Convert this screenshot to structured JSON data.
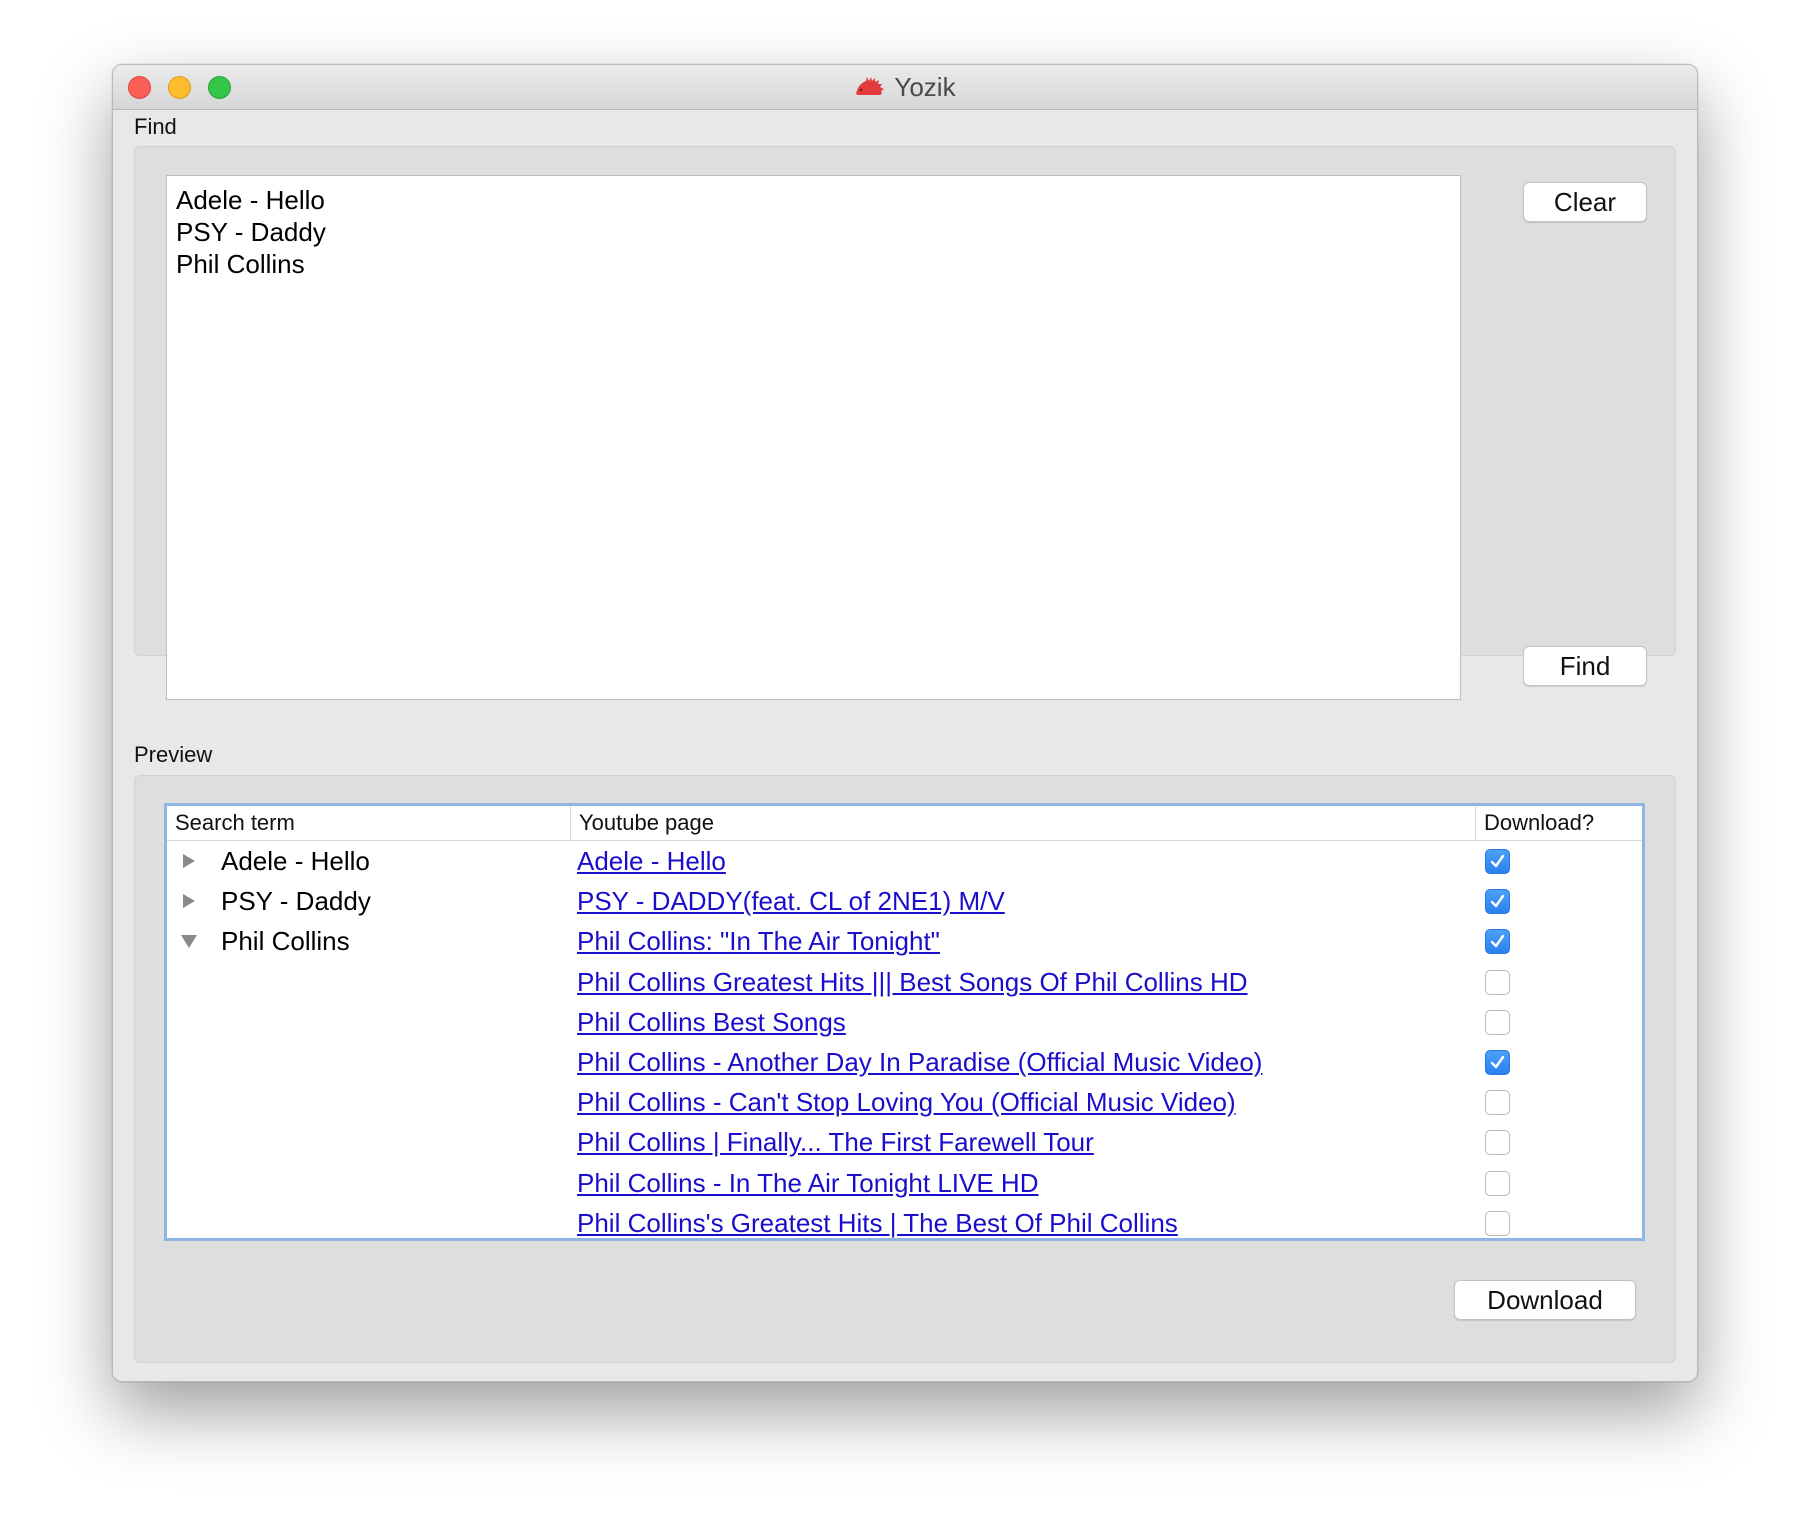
{
  "window": {
    "title": "Yozik",
    "app_icon": "hedgehog-icon",
    "traffic_lights": {
      "close": "#fc5f57",
      "minimize": "#fdbc2e",
      "zoom": "#33c648"
    }
  },
  "find": {
    "section_label": "Find",
    "query_lines": [
      "Adele - Hello",
      "PSY - Daddy",
      "Phil Collins"
    ],
    "clear_button": "Clear",
    "find_button": "Find"
  },
  "preview": {
    "section_label": "Preview",
    "columns": [
      "Search term",
      "Youtube page",
      "Download?"
    ],
    "rows": [
      {
        "term": "Adele - Hello",
        "disclosure": "collapsed",
        "link": "Adele - Hello",
        "checked": true
      },
      {
        "term": "PSY - Daddy",
        "disclosure": "collapsed",
        "link": "PSY - DADDY(feat. CL of 2NE1) M/V",
        "checked": true
      },
      {
        "term": "Phil Collins",
        "disclosure": "expanded",
        "link": "Phil Collins: \"In The Air Tonight\"",
        "checked": true
      },
      {
        "term": "",
        "disclosure": "none",
        "link": "Phil Collins Greatest Hits ||| Best Songs Of Phil Collins HD",
        "checked": false
      },
      {
        "term": "",
        "disclosure": "none",
        "link": "Phil Collins Best Songs",
        "checked": false
      },
      {
        "term": "",
        "disclosure": "none",
        "link": "Phil Collins - Another Day In Paradise (Official Music Video)",
        "checked": true
      },
      {
        "term": "",
        "disclosure": "none",
        "link": "Phil Collins - Can't Stop Loving You (Official Music Video)",
        "checked": false
      },
      {
        "term": "",
        "disclosure": "none",
        "link": "Phil Collins | Finally... The First Farewell Tour",
        "checked": false
      },
      {
        "term": "",
        "disclosure": "none",
        "link": "Phil Collins - In The Air Tonight LIVE HD",
        "checked": false
      },
      {
        "term": "",
        "disclosure": "none",
        "link": "Phil Collins's Greatest Hits | The Best Of Phil Collins",
        "checked": false
      }
    ],
    "download_button": "Download"
  },
  "colors": {
    "link": "#1a0dcc",
    "checkbox_accent": "#2b80ef",
    "table_focus_border": "#8fb4e6"
  }
}
